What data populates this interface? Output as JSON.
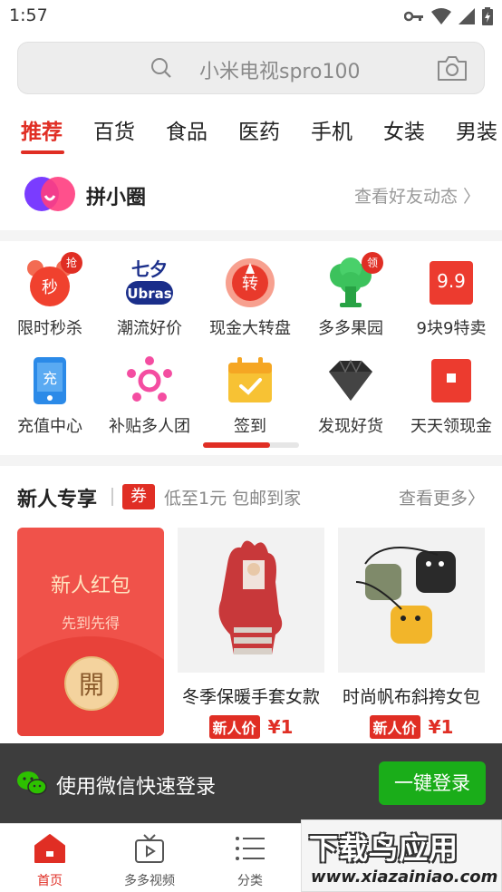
{
  "status_bar": {
    "time": "1:57"
  },
  "search": {
    "placeholder": "小米电视spro100"
  },
  "tabs": [
    "推荐",
    "百货",
    "食品",
    "医药",
    "手机",
    "女装",
    "男装"
  ],
  "circle": {
    "title": "拼小圈",
    "link": "查看好友动态 〉"
  },
  "grid": {
    "row1": [
      {
        "label": "限时秒杀",
        "icon": "alarm-clock-icon",
        "badge": "抢",
        "glyph": "秒"
      },
      {
        "label": "潮流好价",
        "icon": "ubras-logo-icon",
        "glyph": "Ubras"
      },
      {
        "label": "现金大转盘",
        "icon": "wheel-icon",
        "glyph": "转"
      },
      {
        "label": "多多果园",
        "icon": "tree-icon",
        "badge": "领"
      },
      {
        "label": "9块9特卖",
        "icon": "sale-icon",
        "glyph": "9.9"
      }
    ],
    "row2": [
      {
        "label": "充值中心",
        "icon": "phone-recharge-icon",
        "glyph": "充"
      },
      {
        "label": "补贴多人团",
        "icon": "group-icon"
      },
      {
        "label": "签到",
        "icon": "calendar-check-icon"
      },
      {
        "label": "发现好货",
        "icon": "diamond-icon"
      },
      {
        "label": "天天领现金",
        "icon": "red-envelope-icon"
      }
    ]
  },
  "new_user": {
    "title": "新人专享",
    "coupon": "券",
    "subtitle": "低至1元 包邮到家",
    "more": "查看更多〉",
    "redpack": {
      "title": "新人红包",
      "subtitle": "先到先得",
      "coin": "開"
    },
    "products": [
      {
        "name": "冬季保暖手套女款",
        "tag": "新人价",
        "price": "¥1"
      },
      {
        "name": "时尚帆布斜挎女包",
        "tag": "新人价",
        "price": "¥1"
      }
    ]
  },
  "login_bar": {
    "text": "使用微信快速登录",
    "button": "一键登录"
  },
  "bottom_nav": [
    {
      "label": "首页",
      "icon": "home-icon",
      "active": true
    },
    {
      "label": "多多视频",
      "icon": "tv-icon"
    },
    {
      "label": "分类",
      "icon": "list-icon"
    }
  ],
  "watermark": {
    "title": "下载鸟应用",
    "url": "www.xiazainiao.com"
  },
  "colors": {
    "accent": "#e02e24",
    "wechat_green": "#1aad19"
  }
}
